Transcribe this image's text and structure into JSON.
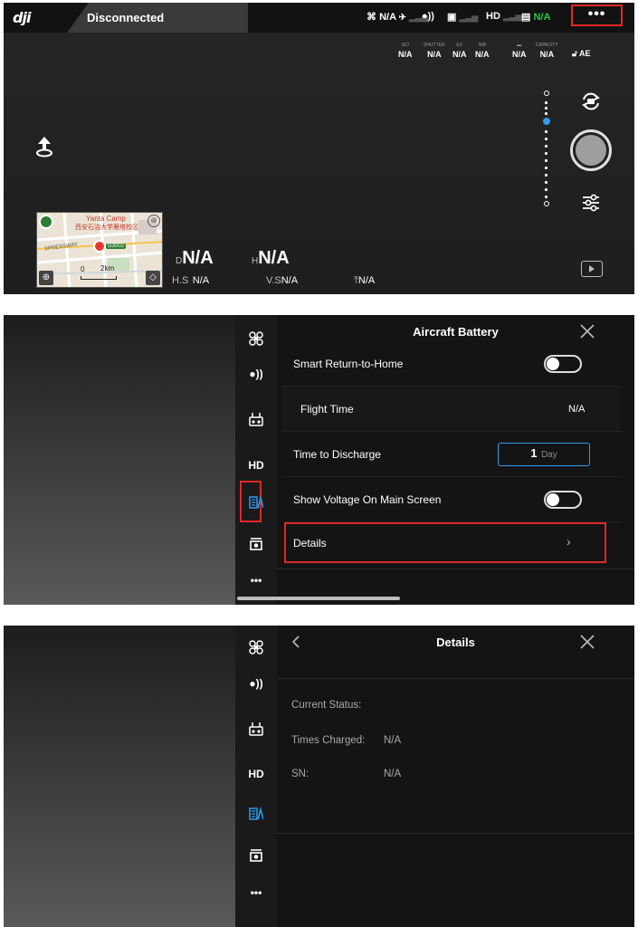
{
  "screen1": {
    "status": "Disconnected",
    "aircraft_signal_value": "N/A",
    "video_label": "HD",
    "battery_value": "N/A",
    "more_label": "•••",
    "exposure": [
      {
        "label": "ISO",
        "value": "N/A"
      },
      {
        "label": "SHUTTER",
        "value": "N/A"
      },
      {
        "label": "EV",
        "value": "N/A"
      },
      {
        "label": "WB",
        "value": "N/A"
      },
      {
        "label": "",
        "value": "N/A"
      },
      {
        "label": "CAPACITY",
        "value": "N/A"
      }
    ],
    "ae_lock_label": "AE",
    "telemetry": {
      "d_label": "D",
      "d_value": "N/A",
      "h_label": "H",
      "h_value": "N/A",
      "hs_label": "H.S",
      "hs_value": "N/A",
      "vs_label": "V.S",
      "vs_value": "N/A",
      "vps_value": "N/A"
    },
    "map": {
      "place_1": "Yanta Camp",
      "place_2": "西安石油大学雁塔校区",
      "road": "XPRESSWAY",
      "road_sign": "G3002",
      "scale": "2km",
      "scale_zero": "0"
    }
  },
  "screen2": {
    "title": "Aircraft Battery",
    "nav_hd": "HD",
    "nav_more": "•••",
    "rows": {
      "smart_rth": "Smart Return-to-Home",
      "flight_time_label": "Flight Time",
      "flight_time_value": "N/A",
      "discharge_label": "Time to Discharge",
      "discharge_value": "1",
      "discharge_unit": "Day",
      "voltage_label": "Show Voltage On Main Screen",
      "details_label": "Details"
    }
  },
  "screen3": {
    "title": "Details",
    "nav_hd": "HD",
    "nav_more": "•••",
    "current_status_label": "Current Status:",
    "times_charged_label": "Times Charged:",
    "times_charged_value": "N/A",
    "sn_label": "SN:",
    "sn_value": "N/A"
  },
  "colors": {
    "accent_blue": "#2f9dee",
    "highlight_red": "#e12727",
    "battery_green": "#27c93f"
  }
}
